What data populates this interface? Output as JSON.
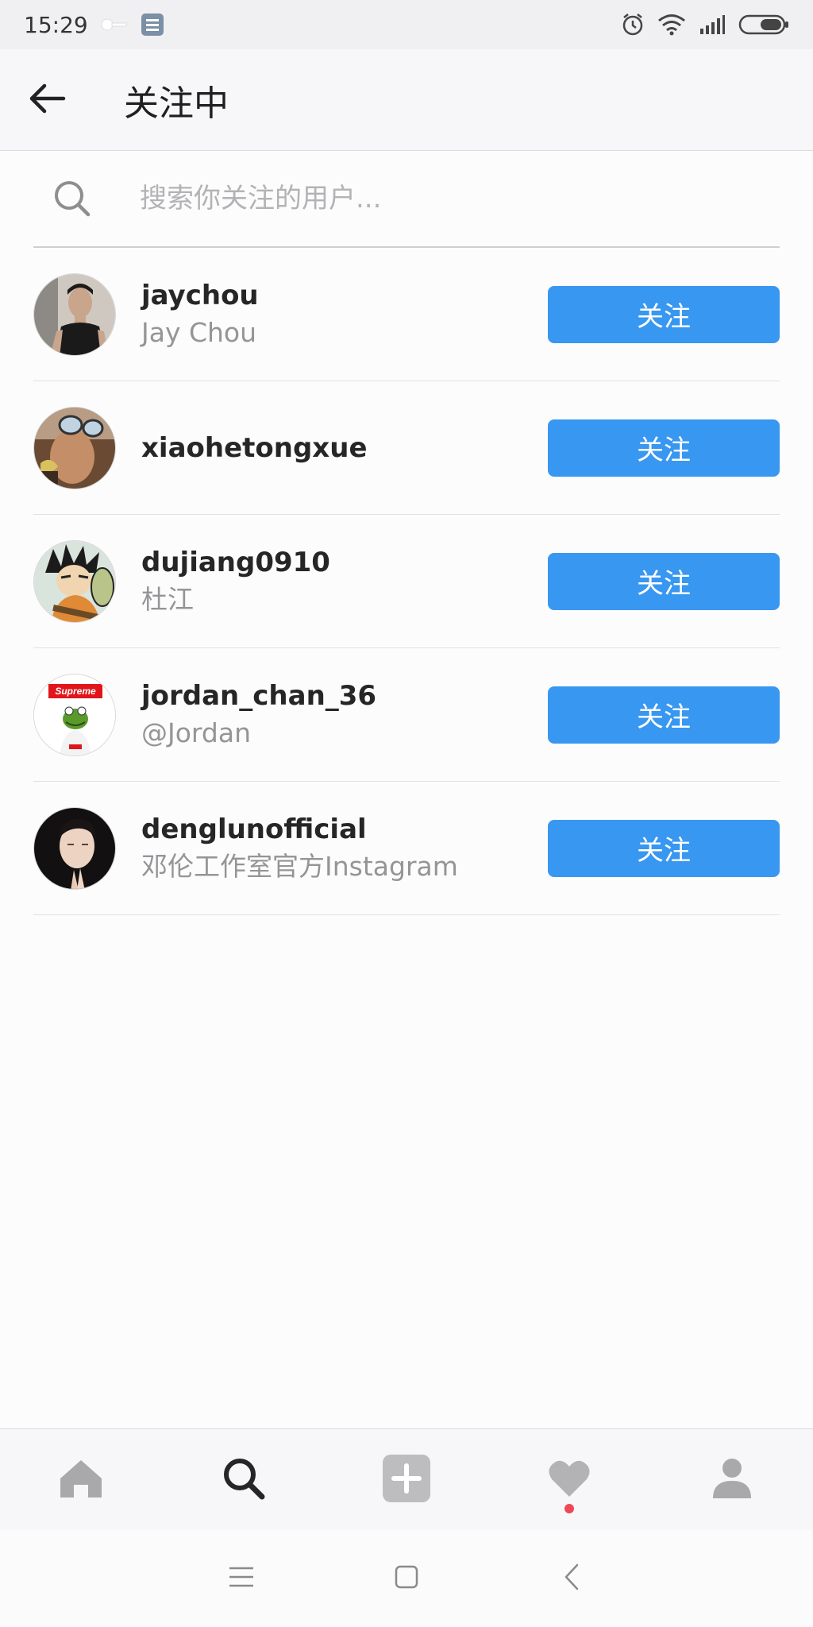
{
  "status_bar": {
    "time": "15:29"
  },
  "header": {
    "title": "关注中"
  },
  "search": {
    "placeholder": "搜索你关注的用户..."
  },
  "users": [
    {
      "username": "jaychou",
      "fullname": "Jay Chou",
      "button": "关注"
    },
    {
      "username": "xiaohetongxue",
      "fullname": "",
      "button": "关注"
    },
    {
      "username": "dujiang0910",
      "fullname": "杜江",
      "button": "关注"
    },
    {
      "username": "jordan_chan_36",
      "fullname": "@Jordan",
      "button": "关注"
    },
    {
      "username": "denglunofficial",
      "fullname": "邓伦工作室官方Instagram",
      "button": "关注"
    }
  ],
  "avatar_badges": {
    "supreme": "Supreme"
  },
  "colors": {
    "accent": "#3897f0",
    "notification": "#ed4956"
  },
  "icons": {
    "tabs": [
      "home-icon",
      "search-icon",
      "add-post-icon",
      "heart-icon",
      "profile-icon"
    ],
    "system_nav": [
      "menu-icon",
      "home-square-icon",
      "back-chevron-icon"
    ]
  }
}
